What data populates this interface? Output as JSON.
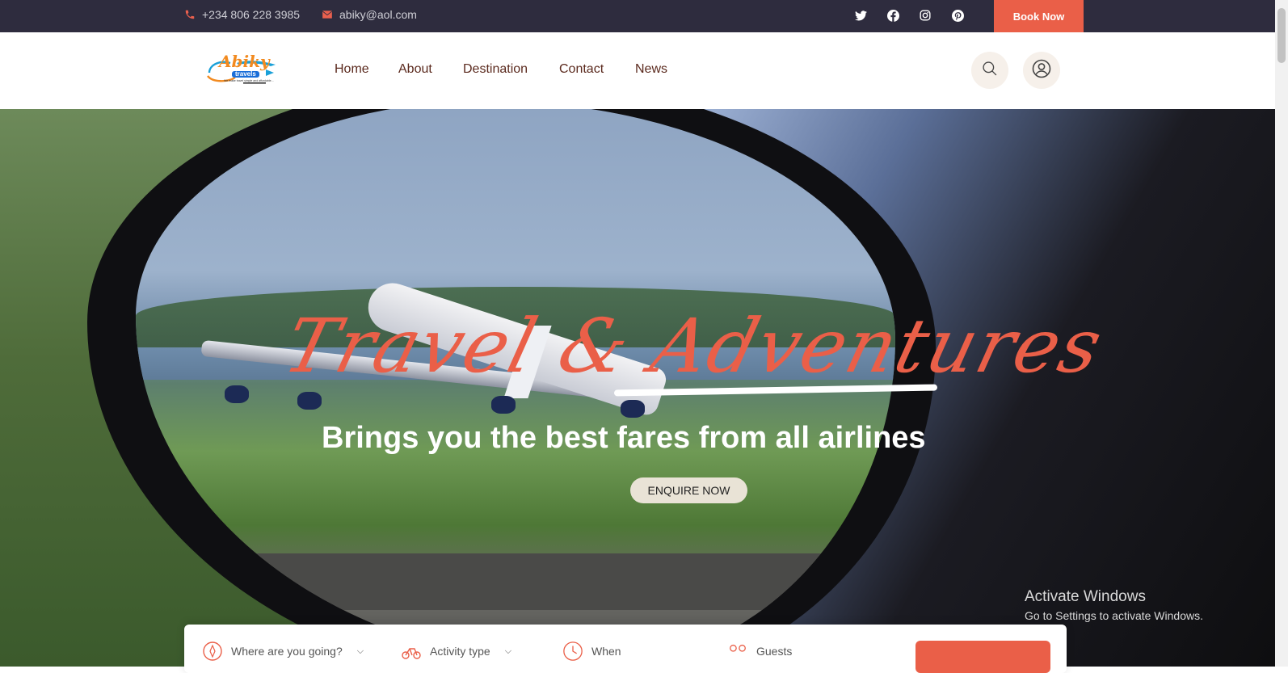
{
  "topbar": {
    "phone": "+234 806 228 3985",
    "email": "abiky@aol.com",
    "socials": [
      "twitter-icon",
      "facebook-icon",
      "instagram-icon",
      "pinterest-icon"
    ],
    "book_label": "Book Now"
  },
  "header": {
    "logo_text": "Abiky",
    "logo_sub": "travels",
    "logo_tagline": "We make travel simple and affordable...",
    "nav": [
      {
        "label": "Home"
      },
      {
        "label": "About"
      },
      {
        "label": "Destination"
      },
      {
        "label": "Contact"
      },
      {
        "label": "News"
      }
    ]
  },
  "hero": {
    "script_title": "Travel & Adventures",
    "subtitle": "Brings you the best fares from all airlines",
    "cta_label": "ENQUIRE NOW"
  },
  "search": {
    "destination_placeholder": "Where are you going?",
    "activity_placeholder": "Activity type",
    "when_placeholder": "When",
    "guests_placeholder": "Guests"
  },
  "watermark": {
    "line1": "Activate Windows",
    "line2": "Go to Settings to activate Windows."
  },
  "colors": {
    "accent": "#ea5f48",
    "topbar_bg": "#2e2c3e",
    "nav_text": "#5b2a1e"
  }
}
